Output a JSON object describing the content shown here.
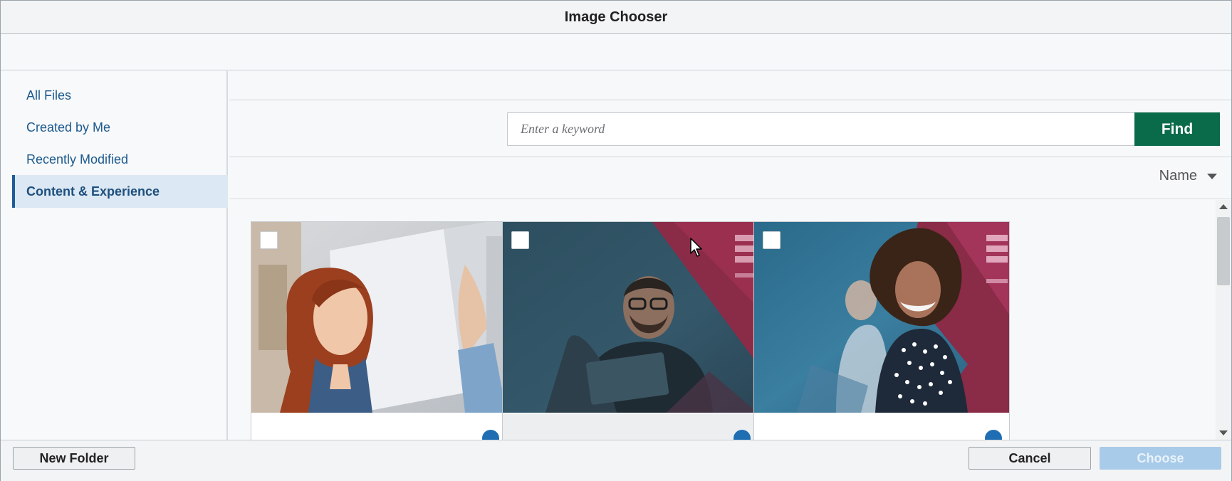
{
  "dialog": {
    "title": "Image Chooser"
  },
  "sidebar": {
    "items": [
      {
        "label": "All Files",
        "active": false
      },
      {
        "label": "Created by Me",
        "active": false
      },
      {
        "label": "Recently Modified",
        "active": false
      },
      {
        "label": "Content & Experience",
        "active": true
      }
    ]
  },
  "search": {
    "placeholder": "Enter a keyword",
    "value": "",
    "button_label": "Find"
  },
  "sort": {
    "label": "Name",
    "icon": "caret-down-icon"
  },
  "gallery": {
    "items": [
      {
        "checked": false,
        "thumbnail": "woman-presenting-whiteboard"
      },
      {
        "checked": false,
        "thumbnail": "man-with-glasses-smiling"
      },
      {
        "checked": false,
        "thumbnail": "woman-smiling-curly-hair"
      }
    ]
  },
  "footer": {
    "new_folder_label": "New Folder",
    "cancel_label": "Cancel",
    "choose_label": "Choose",
    "choose_enabled": false
  },
  "colors": {
    "find_button": "#0a6b4b",
    "active_nav_bg": "#dce8f3",
    "active_nav_border": "#1f5c99",
    "nav_text": "#1c5a8e",
    "choose_disabled": "#a7cbe8",
    "info_dot": "#1f6eb3"
  }
}
